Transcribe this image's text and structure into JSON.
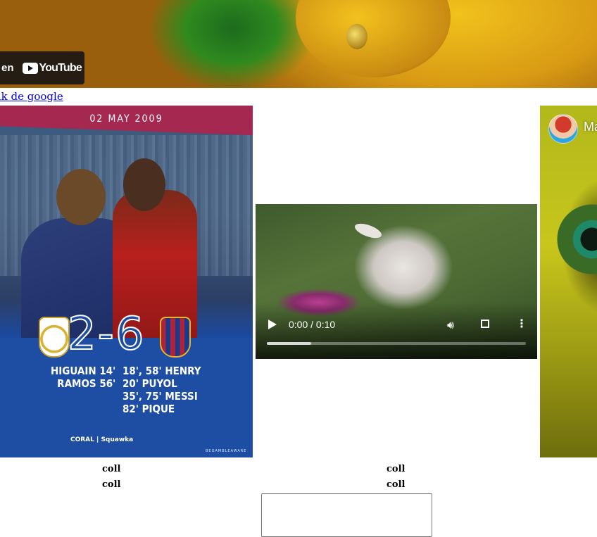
{
  "youtube_top": {
    "watch_on_label": "r en",
    "brand": "YouTube"
  },
  "link": {
    "text": "nk de google"
  },
  "poster": {
    "date": "02 MAY 2009",
    "score": "2-6",
    "home_scorers": [
      "HIGUAIN 14'",
      "RAMOS 56'"
    ],
    "away_scorers": [
      "18', 58' HENRY",
      "20' PUYOL",
      "35', 75' MESSI",
      "82' PIQUE"
    ],
    "sponsor": "CORAL | Squawka",
    "gamble": "BEGAMBLEAWARE"
  },
  "video": {
    "time": "0:00 / 0:10",
    "progress": 0.17
  },
  "youtube_right": {
    "channel_partial": "Ma"
  },
  "table": {
    "rows": [
      [
        "coll",
        "coll"
      ],
      [
        "coll",
        "coll"
      ]
    ]
  }
}
